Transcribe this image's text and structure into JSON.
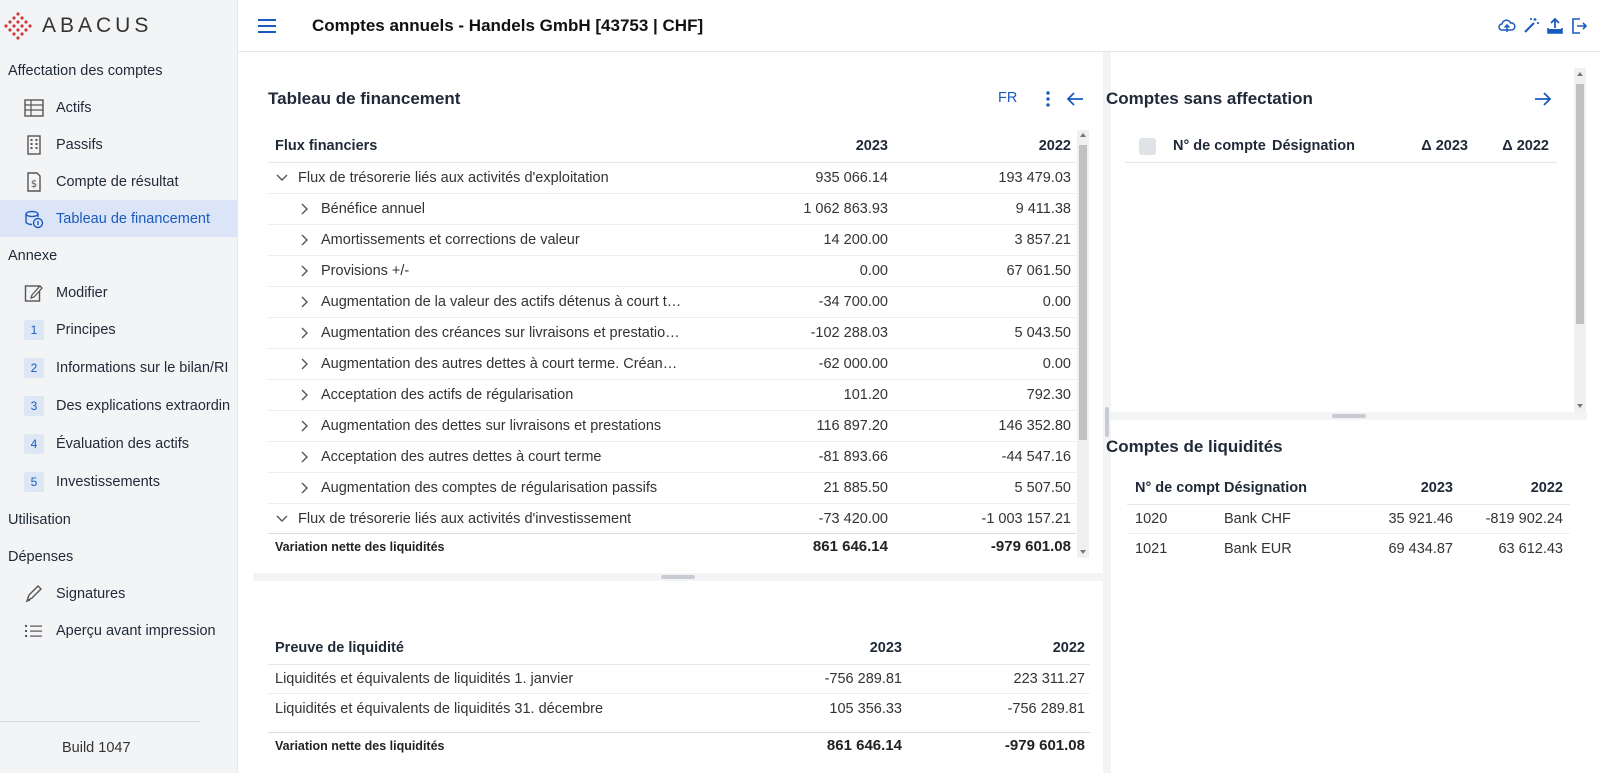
{
  "app": {
    "logo_text": "ABACUS",
    "title": "Comptes annuels - Handels GmbH [43753 | CHF]",
    "build": "Build 1047",
    "accent": "#1a5bbf"
  },
  "sidebar": {
    "sections": [
      {
        "label": "Affectation des comptes"
      },
      {
        "label": "Annexe"
      },
      {
        "label": "Utilisation"
      },
      {
        "label": "Dépenses"
      }
    ],
    "items": [
      {
        "label": "Actifs",
        "icon": "balance-table-icon"
      },
      {
        "label": "Passifs",
        "icon": "building-icon"
      },
      {
        "label": "Compte de résultat",
        "icon": "document-dollar-icon"
      },
      {
        "label": "Tableau de financement",
        "icon": "coins-icon",
        "active": true
      },
      {
        "label": "Modifier",
        "icon": "edit-icon"
      },
      {
        "label": "Principes",
        "num": "1"
      },
      {
        "label": "Informations sur le bilan/RI",
        "num": "2"
      },
      {
        "label": "Des explications extraordin",
        "num": "3"
      },
      {
        "label": "Évaluation des actifs",
        "num": "4"
      },
      {
        "label": "Investissements",
        "num": "5"
      },
      {
        "label": "Signatures",
        "icon": "pen-icon"
      },
      {
        "label": "Aperçu avant impression",
        "icon": "list-icon"
      }
    ]
  },
  "financement": {
    "title": "Tableau de financement",
    "lang": "FR",
    "columns": [
      "Flux financiers",
      "2023",
      "2022"
    ],
    "rows": [
      {
        "label": "Flux de trésorerie liés aux activités d'exploitation",
        "v2023": "935 066.14",
        "v2022": "193 479.03"
      },
      {
        "label": "Bénéfice annuel",
        "v2023": "1 062 863.93",
        "v2022": "9 411.38"
      },
      {
        "label": "Amortissements et corrections de valeur",
        "v2023": "14 200.00",
        "v2022": "3 857.21"
      },
      {
        "label": "Provisions +/-",
        "v2023": "0.00",
        "v2022": "67 061.50"
      },
      {
        "label": "Augmentation de la valeur des actifs détenus à court t…",
        "v2023": "-34 700.00",
        "v2022": "0.00"
      },
      {
        "label": "Augmentation des créances sur livraisons et prestatio…",
        "v2023": "-102 288.03",
        "v2022": "5 043.50"
      },
      {
        "label": "Augmentation des autres dettes à court terme. Créan…",
        "v2023": "-62 000.00",
        "v2022": "0.00"
      },
      {
        "label": "Acceptation des actifs de régularisation",
        "v2023": "101.20",
        "v2022": "792.30"
      },
      {
        "label": "Augmentation des dettes sur livraisons et prestations",
        "v2023": "116 897.20",
        "v2022": "146 352.80"
      },
      {
        "label": "Acceptation des autres dettes à court terme",
        "v2023": "-81 893.66",
        "v2022": "-44 547.16"
      },
      {
        "label": "Augmentation des comptes de régularisation passifs",
        "v2023": "21 885.50",
        "v2022": "5 507.50"
      },
      {
        "label": "Flux de trésorerie liés aux activités d'investissement",
        "v2023": "-73 420.00",
        "v2022": "-1 003 157.21"
      }
    ],
    "total": {
      "label": "Variation nette des liquidités",
      "v2023": "861 646.14",
      "v2022": "-979 601.08"
    }
  },
  "proof": {
    "columns": [
      "Preuve de liquidité",
      "2023",
      "2022"
    ],
    "rows": [
      {
        "label": "Liquidités et équivalents de liquidités 1. janvier",
        "v2023": "-756 289.81",
        "v2022": "223 311.27"
      },
      {
        "label": "Liquidités et équivalents de liquidités 31. décembre",
        "v2023": "105 356.33",
        "v2022": "-756 289.81"
      }
    ],
    "total": {
      "label": "Variation nette des liquidités",
      "v2023": "861 646.14",
      "v2022": "-979 601.08"
    }
  },
  "sans_affectation": {
    "title": "Comptes sans affectation",
    "columns": [
      "N° de compte",
      "Désignation",
      "Δ 2023",
      "Δ 2022"
    ]
  },
  "liquidites": {
    "title": "Comptes de liquidités",
    "columns": [
      "N° de compte",
      "Désignation",
      "2023",
      "2022"
    ],
    "rows": [
      {
        "num": "1020",
        "desc": "Bank CHF",
        "v2023": "35 921.46",
        "v2022": "-819 902.24"
      },
      {
        "num": "1021",
        "desc": "Bank EUR",
        "v2023": "69 434.87",
        "v2022": "63 612.43"
      }
    ]
  }
}
